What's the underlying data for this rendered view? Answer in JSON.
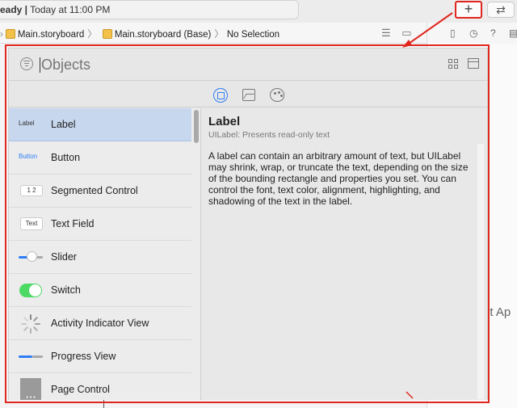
{
  "toolbar": {
    "status_bold": "eady |",
    "status_rest": " Today at 11:00 PM",
    "plus_glyph": "+",
    "swap_glyph": "⇄"
  },
  "breadcrumb": {
    "item1": "Main.storyboard",
    "item2": "Main.storyboard (Base)",
    "item3": "No Selection",
    "sep": "〉"
  },
  "background": {
    "partial_text": "ot Ap"
  },
  "library": {
    "search_placeholder": "Objects",
    "items": [
      {
        "label": "Label",
        "icon_text": "Label"
      },
      {
        "label": "Button",
        "icon_text": "Button"
      },
      {
        "label": "Segmented Control",
        "icon_text": "1  2"
      },
      {
        "label": "Text Field",
        "icon_text": "Text"
      },
      {
        "label": "Slider",
        "icon_text": ""
      },
      {
        "label": "Switch",
        "icon_text": ""
      },
      {
        "label": "Activity Indicator View",
        "icon_text": ""
      },
      {
        "label": "Progress View",
        "icon_text": ""
      },
      {
        "label": "Page Control",
        "icon_text": ""
      }
    ],
    "detail": {
      "title": "Label",
      "subtitle": "UILabel: Presents read-only text",
      "description": "A label can contain an arbitrary amount of text, but UILabel may shrink, wrap, or truncate the text, depending on the size of the bounding rectangle and properties you set. You can control the font, text color, alignment, highlighting, and shadowing of the text in the label."
    }
  },
  "colors": {
    "highlight_red": "#e0261e",
    "accent_blue": "#2f7df6",
    "switch_green": "#4cd964"
  }
}
